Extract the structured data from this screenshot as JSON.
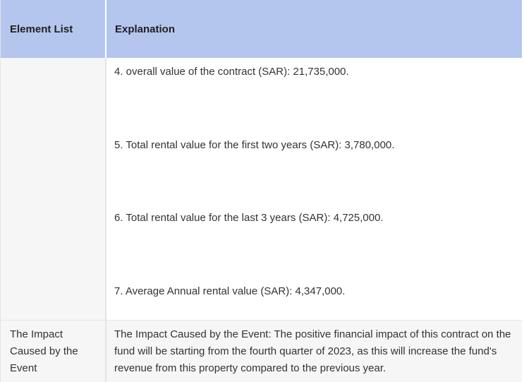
{
  "table": {
    "headers": {
      "element_list": "Element List",
      "explanation": "Explanation"
    },
    "row1": {
      "element": "",
      "items": [
        "4. overall value of the contract (SAR): 21,735,000.",
        "5. Total rental value for the first two years (SAR): 3,780,000.",
        "6. Total rental value for the last 3 years (SAR): 4,725,000.",
        "7. Average Annual rental value (SAR): 4,347,000."
      ]
    },
    "row2": {
      "element": "The Impact Caused by the Event",
      "explanation": "The Impact Caused by the Event: The positive financial impact of this contract on the fund will be starting from the fourth quarter of 2023, as this will increase the fund's revenue from this property compared to the previous year."
    }
  }
}
